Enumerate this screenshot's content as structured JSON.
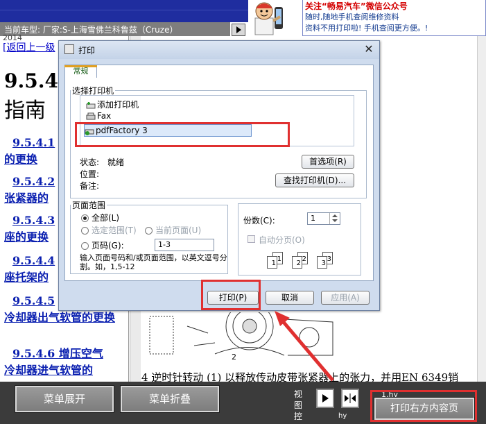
{
  "header": {
    "ad_title": "关注“畅易汽车”微信公众号",
    "ad_line1": "随时,随地手机查阅维修资料",
    "ad_line2": "资料不用打印啦! 手机查阅更方便。!",
    "model_label": "当前车型:  厂家:S-上海雪佛兰科鲁兹（Cruze）",
    "year": "2014"
  },
  "toc": {
    "back_link": "[返回上一级",
    "heading_number": "9.5.4",
    "heading_rest": "指南",
    "items": [
      {
        "label": "9.5.4.1",
        "rest": "的更换"
      },
      {
        "label": "9.5.4.2",
        "rest": "张紧器的"
      },
      {
        "label": "9.5.4.3",
        "rest": "座的更换"
      },
      {
        "label": "9.5.4.4",
        "rest": "座托架的"
      },
      {
        "label": "9.5.4.5",
        "rest": "冷却器出气软管的更换"
      },
      {
        "label": "9.5.4.6 增压空气",
        "rest": "冷却器进气软管的"
      }
    ]
  },
  "content": {
    "figure_number": "2",
    "step_text": "4 逆时针转动 (1) 以释放传动皮带张紧器上的张力，并用EN 6349销"
  },
  "bottom": {
    "expand_button": "菜单展开",
    "collapse_button": "菜单折叠",
    "view_label": "视图",
    "view_label2": "控",
    "badge_top": "1.hy",
    "badge_bottom": "hy",
    "print_right_button": "打印右方内容页"
  },
  "dialog": {
    "title": "打印",
    "tab": "常规",
    "select_printer_legend": "选择打印机",
    "printers": [
      {
        "name": "添加打印机",
        "icon": "add-printer-icon"
      },
      {
        "name": "Fax",
        "icon": "fax-icon"
      },
      {
        "name": "pdfFactory 3",
        "icon": "printer-default-icon"
      }
    ],
    "status_label": "状态:",
    "status_value": "就绪",
    "location_label": "位置:",
    "comment_label": "备注:",
    "preferences_button": "首选项(R)",
    "find_printer_button": "查找打印机(D)...",
    "page_range_legend": "页面范围",
    "range_all": "全部(L)",
    "range_selection": "选定范围(T)",
    "range_current": "当前页面(U)",
    "range_pages": "页码(G):",
    "pages_value": "1-3",
    "hint": "输入页面号码和/或页面范围，以英文逗号分割。如，1,5-12",
    "copies_label": "份数(C):",
    "copies_value": "1",
    "collate_label": "自动分页(O)",
    "print_button": "打印(P)",
    "cancel_button": "取消",
    "apply_button": "应用(A)"
  },
  "colors": {
    "header_blue": "#1f2d9f",
    "link_blue": "#0a1fb0",
    "annotation_red": "#e03030",
    "dialog_frame": "#cfdcee",
    "toolbar": "#3b3b3b"
  }
}
